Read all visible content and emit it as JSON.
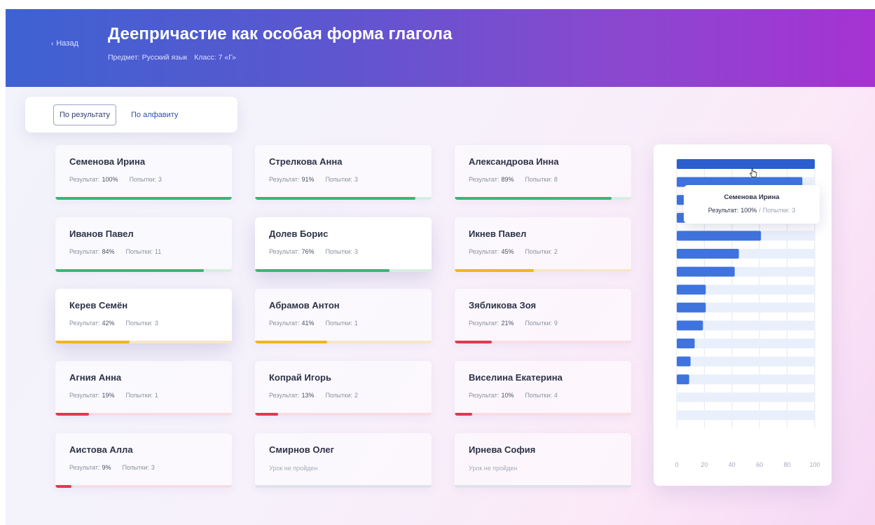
{
  "header": {
    "back_label": "Назад",
    "title": "Деепричастие как особая форма глагола",
    "subject_label": "Предмет:",
    "subject_value": "Русский язык",
    "class_label": "Класс:",
    "class_value": "7 «Г»"
  },
  "sort": {
    "by_result": "По результату",
    "by_alphabet": "По алфавиту",
    "active": "by_result"
  },
  "labels": {
    "result": "Результат:",
    "attempts": "Попытки:",
    "not_passed": "Урок не пройден"
  },
  "colors": {
    "green": "#3bb673",
    "yellow": "#f2b51c",
    "red": "#e0394f",
    "track_green": "#d6eee1",
    "track_yellow": "#f7e6c7",
    "track_red": "#f9dde4",
    "track_gray": "#dfe2ea",
    "chart_bar": "#3f73de",
    "chart_bar_active": "#2b5fcf",
    "chart_track": "#eaf0fb"
  },
  "students": [
    {
      "name": "Семенова Ирина",
      "result": "100%",
      "attempts": "3",
      "percent": 100,
      "status": "green"
    },
    {
      "name": "Стрелкова Анна",
      "result": "91%",
      "attempts": "3",
      "percent": 91,
      "status": "green"
    },
    {
      "name": "Александрова Инна",
      "result": "89%",
      "attempts": "8",
      "percent": 89,
      "status": "green"
    },
    {
      "name": "Иванов Павел",
      "result": "84%",
      "attempts": "11",
      "percent": 84,
      "status": "green"
    },
    {
      "name": "Долев Борис",
      "result": "76%",
      "attempts": "3",
      "percent": 76,
      "status": "green",
      "raised": true
    },
    {
      "name": "Икнев Павел",
      "result": "45%",
      "attempts": "2",
      "percent": 45,
      "status": "yellow"
    },
    {
      "name": "Керев Семён",
      "result": "42%",
      "attempts": "3",
      "percent": 42,
      "status": "yellow",
      "raised": true
    },
    {
      "name": "Абрамов Антон",
      "result": "41%",
      "attempts": "1",
      "percent": 41,
      "status": "yellow"
    },
    {
      "name": "Зябликова Зоя",
      "result": "21%",
      "attempts": "9",
      "percent": 21,
      "status": "red"
    },
    {
      "name": "Агния Анна",
      "result": "19%",
      "attempts": "1",
      "percent": 19,
      "status": "red"
    },
    {
      "name": "Копрай Игорь",
      "result": "13%",
      "attempts": "2",
      "percent": 13,
      "status": "red"
    },
    {
      "name": "Виселина Екатерина",
      "result": "10%",
      "attempts": "4",
      "percent": 10,
      "status": "red"
    },
    {
      "name": "Аистова Алла",
      "result": "9%",
      "attempts": "3",
      "percent": 9,
      "status": "red"
    },
    {
      "name": "Смирнов Олег",
      "not_passed": true,
      "percent": 0,
      "status": "gray"
    },
    {
      "name": "Ирнева София",
      "not_passed": true,
      "percent": 0,
      "status": "gray"
    }
  ],
  "chart_data": {
    "type": "bar",
    "orientation": "horizontal",
    "categories": [
      "Семенова Ирина",
      "Стрелкова Анна",
      "Александрова Инна",
      "Иванов Павел",
      "Долев Борис",
      "Икнев Павел",
      "Керев Семён",
      "Абрамов Антон",
      "Зябликова Зоя",
      "Агния Анна",
      "Копрай Игорь",
      "Виселина Екатерина",
      "Аистова Алла",
      "Смирнов Олег",
      "Ирнева София"
    ],
    "values": [
      100,
      91,
      89,
      68,
      61,
      45,
      42,
      21,
      21,
      19,
      13,
      10,
      9,
      0,
      0
    ],
    "xlim": [
      0,
      100
    ],
    "xticks": [
      "0",
      "20",
      "40",
      "60",
      "80",
      "100"
    ],
    "grid": true,
    "highlighted": 0
  },
  "tooltip": {
    "name": "Семенова Ирина",
    "result_label": "Результат:",
    "result_value": "100%",
    "separator": "/",
    "attempts_label": "Попытки:",
    "attempts_value": "3"
  }
}
